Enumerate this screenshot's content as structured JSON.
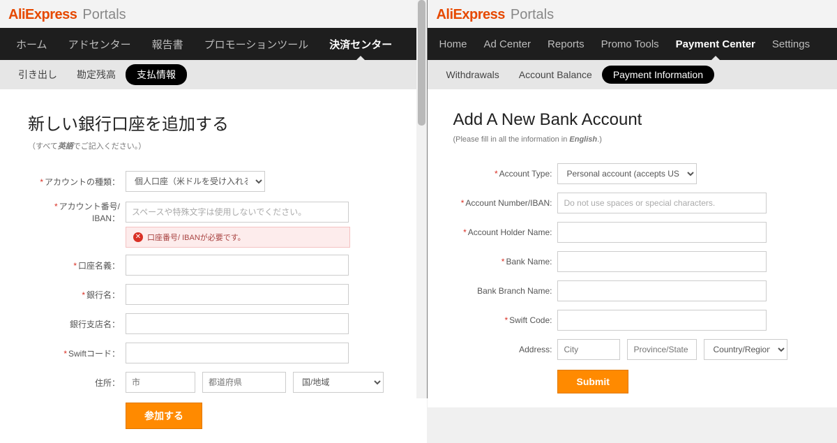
{
  "left": {
    "brand": {
      "ali": "AliExpress",
      "portals": "Portals"
    },
    "nav": [
      "ホーム",
      "アドセンター",
      "報告書",
      "プロモーションツール",
      "決済センター"
    ],
    "nav_active_index": 4,
    "subnav": [
      "引き出し",
      "勘定残高",
      "支払情報"
    ],
    "subnav_active_index": 2,
    "title": "新しい銀行口座を追加する",
    "subtitle_prefix": "（すべて",
    "subtitle_em": "英語",
    "subtitle_suffix": "でご記入ください。）",
    "labels": {
      "account_type": "アカウントの種類：",
      "account_number": "アカウント番号/ IBAN：",
      "account_holder": "口座名義：",
      "bank_name": "銀行名：",
      "branch_name": "銀行支店名：",
      "swift": "Swiftコード：",
      "address": "住所："
    },
    "account_type_value": "個人口座（米ドルを受け入れる）",
    "account_number_placeholder": "スペースや特殊文字は使用しないでください。",
    "error_text": "口座番号/ IBANが必要です。",
    "address": {
      "city": "市",
      "province": "都道府県",
      "country": "国/地域"
    },
    "submit": "参加する"
  },
  "right": {
    "brand": {
      "ali": "AliExpress",
      "portals": "Portals"
    },
    "nav": [
      "Home",
      "Ad Center",
      "Reports",
      "Promo Tools",
      "Payment Center",
      "Settings"
    ],
    "nav_active_index": 4,
    "subnav": [
      "Withdrawals",
      "Account Balance",
      "Payment Information"
    ],
    "subnav_active_index": 2,
    "title": "Add A New Bank Account",
    "subtitle_prefix": "(Please fill in all the information in ",
    "subtitle_em": "English",
    "subtitle_suffix": ".)",
    "labels": {
      "account_type": "Account Type:",
      "account_number": "Account Number/IBAN:",
      "account_holder": "Account Holder Name:",
      "bank_name": "Bank Name:",
      "branch_name": "Bank Branch Name:",
      "swift": "Swift Code:",
      "address": "Address:"
    },
    "account_type_value": "Personal account (accepts USD)",
    "account_number_placeholder": "Do not use spaces or special characters.",
    "address": {
      "city": "City",
      "province": "Province/State",
      "country": "Country/Region"
    },
    "submit": "Submit"
  }
}
